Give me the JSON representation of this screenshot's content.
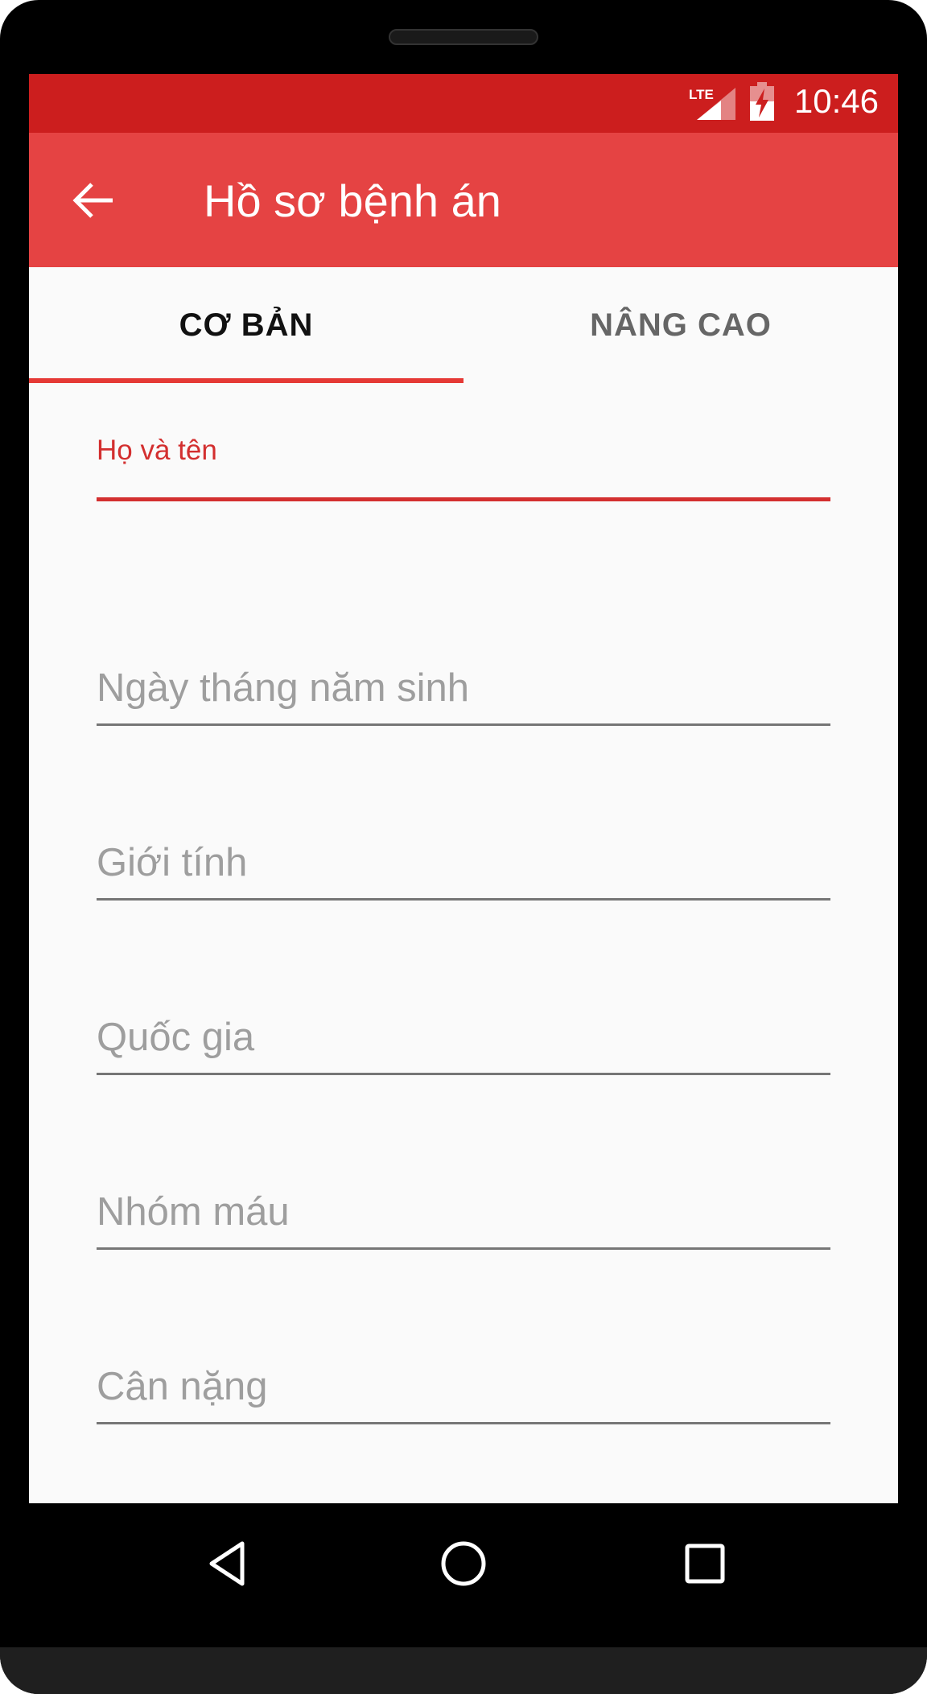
{
  "status_bar": {
    "network": "LTE",
    "time": "10:46",
    "icons": [
      "lte-signal-icon",
      "battery-charging-icon"
    ]
  },
  "app_bar": {
    "back_icon": "arrow-back-icon",
    "title": "Hồ sơ bệnh án"
  },
  "tabs": [
    {
      "label": "CƠ BẢN",
      "selected": true
    },
    {
      "label": "NÂNG CAO",
      "selected": false
    }
  ],
  "form": {
    "fields": [
      {
        "label": "Họ và tên",
        "value": "",
        "focused": true
      },
      {
        "label": "Ngày tháng năm sinh",
        "value": ""
      },
      {
        "label": "Giới tính",
        "value": ""
      },
      {
        "label": "Quốc gia",
        "value": ""
      },
      {
        "label": "Nhóm máu",
        "value": ""
      },
      {
        "label": "Cân nặng",
        "value": ""
      }
    ]
  },
  "nav_bar": {
    "icons": [
      "back-triangle-icon",
      "home-circle-icon",
      "recents-square-icon"
    ]
  },
  "colors": {
    "status_bar": "#cc1e1e",
    "app_bar": "#e54343",
    "accent": "#d32f2f",
    "background": "#fafafa"
  }
}
